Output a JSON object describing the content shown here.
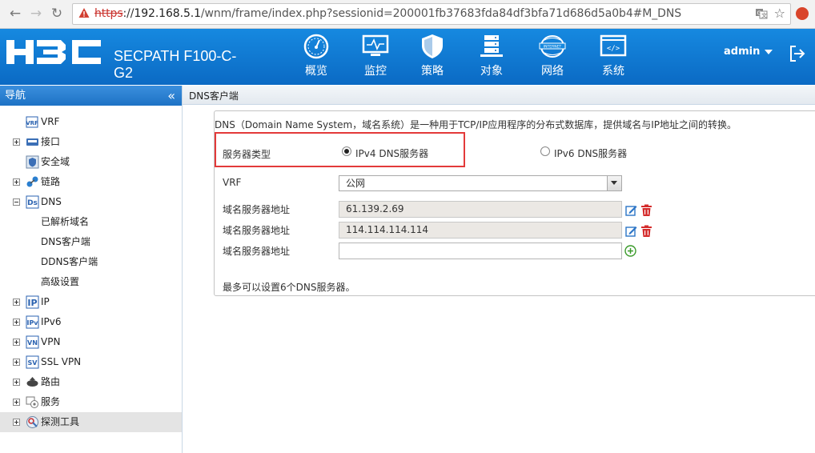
{
  "browser": {
    "url_protocol": "https",
    "url_separator": "://",
    "url_host": "192.168.5.1",
    "url_path": "/wnm/frame/index.php?sessionid=200001fb37683fda84df3bfa71d686d5a0b4#M_DNS"
  },
  "header": {
    "product_line1": "SECPATH F100-C-",
    "product_line2": "G2",
    "nav": [
      "概览",
      "监控",
      "策略",
      "对象",
      "网络",
      "系统"
    ],
    "user": "admin"
  },
  "sidebar": {
    "title": "导航",
    "items": [
      {
        "label": "VRF",
        "icon": "vrf-icon",
        "expander": "none"
      },
      {
        "label": "接口",
        "icon": "interface-icon",
        "expander": "plus"
      },
      {
        "label": "安全域",
        "icon": "security-zone-icon",
        "expander": "none"
      },
      {
        "label": "链路",
        "icon": "link-icon",
        "expander": "plus"
      },
      {
        "label": "DNS",
        "icon": "dns-icon",
        "expander": "minus"
      },
      {
        "label": "已解析域名",
        "icon": "",
        "expander": "none"
      },
      {
        "label": "DNS客户端",
        "icon": "",
        "expander": "none"
      },
      {
        "label": "DDNS客户端",
        "icon": "",
        "expander": "none"
      },
      {
        "label": "高级设置",
        "icon": "",
        "expander": "none"
      },
      {
        "label": "IP",
        "icon": "ip-icon",
        "expander": "plus"
      },
      {
        "label": "IPv6",
        "icon": "ipv6-icon",
        "expander": "plus"
      },
      {
        "label": "VPN",
        "icon": "vpn-icon",
        "expander": "plus"
      },
      {
        "label": "SSL VPN",
        "icon": "ssl-vpn-icon",
        "expander": "plus"
      },
      {
        "label": "路由",
        "icon": "routing-icon",
        "expander": "plus"
      },
      {
        "label": "服务",
        "icon": "service-icon",
        "expander": "plus"
      },
      {
        "label": "探测工具",
        "icon": "probe-tool-icon",
        "expander": "plus",
        "selected": true
      }
    ]
  },
  "content": {
    "title": "DNS客户端",
    "description": "DNS（Domain Name System，域名系统）是一种用于TCP/IP应用程序的分布式数据库，提供域名与IP地址之间的转换。",
    "server_type_label": "服务器类型",
    "ipv4_option": "IPv4 DNS服务器",
    "ipv6_option": "IPv6 DNS服务器",
    "vrf_label": "VRF",
    "vrf_value": "公网",
    "server_label": "域名服务器地址",
    "servers": [
      "61.139.2.69",
      "114.114.114.114"
    ],
    "new_server_value": "",
    "footnote": "最多可以设置6个DNS服务器。"
  }
}
